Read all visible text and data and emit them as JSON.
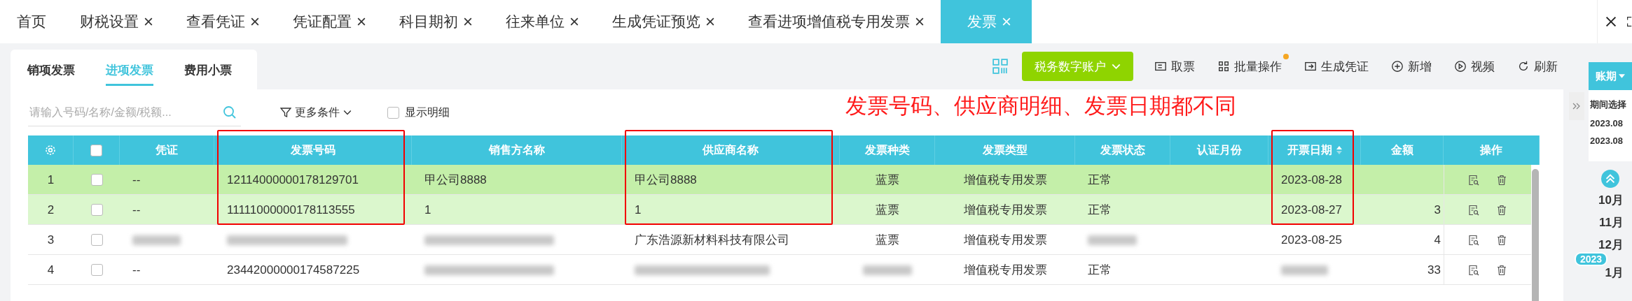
{
  "top_tabs": [
    {
      "label": "首页",
      "closable": false,
      "selected": false
    },
    {
      "label": "财税设置",
      "closable": true,
      "selected": false
    },
    {
      "label": "查看凭证",
      "closable": true,
      "selected": false
    },
    {
      "label": "凭证配置",
      "closable": true,
      "selected": false
    },
    {
      "label": "科目期初",
      "closable": true,
      "selected": false
    },
    {
      "label": "往来单位",
      "closable": true,
      "selected": false
    },
    {
      "label": "生成凭证预览",
      "closable": true,
      "selected": false
    },
    {
      "label": "查看进项增值税专用发票",
      "closable": true,
      "selected": false
    },
    {
      "label": "发票",
      "closable": true,
      "selected": true
    }
  ],
  "sub_tabs": [
    {
      "label": "销项发票",
      "selected": false
    },
    {
      "label": "进项发票",
      "selected": true
    },
    {
      "label": "费用小票",
      "selected": false
    }
  ],
  "toolbar": {
    "account_button": "税务数字账户",
    "actions": [
      {
        "kind": "ticket",
        "label": "取票",
        "badge": false
      },
      {
        "kind": "batch",
        "label": "批量操作",
        "badge": true
      },
      {
        "kind": "voucher",
        "label": "生成凭证",
        "badge": false
      },
      {
        "kind": "add",
        "label": "新增",
        "badge": false
      },
      {
        "kind": "video",
        "label": "视频",
        "badge": false
      },
      {
        "kind": "refresh",
        "label": "刷新",
        "badge": false
      }
    ]
  },
  "search": {
    "placeholder": "请输入号码/名称/金额/税额..."
  },
  "filter": {
    "more_label": "更多条件",
    "show_detail": {
      "label": "显示明细",
      "checked": false
    }
  },
  "annotation": "发票号码、供应商明细、发票日期都不同",
  "table": {
    "header_checked": false,
    "columns": [
      {
        "label": "凭证",
        "highlighted": false,
        "sortable": false
      },
      {
        "label": "发票号码",
        "highlighted": true,
        "sortable": false
      },
      {
        "label": "销售方名称",
        "highlighted": false,
        "sortable": false
      },
      {
        "label": "供应商名称",
        "highlighted": true,
        "sortable": false
      },
      {
        "label": "发票种类",
        "highlighted": false,
        "sortable": false
      },
      {
        "label": "发票类型",
        "highlighted": false,
        "sortable": false
      },
      {
        "label": "发票状态",
        "highlighted": false,
        "sortable": false
      },
      {
        "label": "认证月份",
        "highlighted": false,
        "sortable": false
      },
      {
        "label": "开票日期",
        "highlighted": true,
        "sortable": true
      },
      {
        "label": "金额",
        "highlighted": false,
        "sortable": false
      }
    ],
    "ops_label": "操作",
    "rows": [
      {
        "index": "1",
        "checked": false,
        "color": "#c4efa9",
        "cells": [
          {
            "text": "--"
          },
          {
            "text": "12114000000178129701"
          },
          {
            "text": "甲公司8888"
          },
          {
            "text": "甲公司8888"
          },
          {
            "text": "蓝票"
          },
          {
            "text": "增值税专用发票"
          },
          {
            "text": "正常"
          },
          null,
          {
            "text": "2023-08-28"
          },
          null
        ]
      },
      {
        "index": "2",
        "checked": false,
        "color": "#dbf7cd",
        "cells": [
          {
            "text": "--"
          },
          {
            "text": "11111000000178113555"
          },
          {
            "text": "1"
          },
          {
            "text": "1"
          },
          {
            "text": "蓝票"
          },
          {
            "text": "增值税专用发票"
          },
          {
            "text": "正常"
          },
          null,
          {
            "text": "2023-08-27"
          },
          {
            "text": "3"
          }
        ]
      },
      {
        "index": "3",
        "checked": false,
        "color": "#ffffff",
        "cells": [
          {
            "blurred": true
          },
          {
            "blurred": true
          },
          {
            "blurred": true
          },
          {
            "text": "广东浩源新材料科技有限公司"
          },
          {
            "text": "蓝票"
          },
          {
            "text": "增值税专用发票"
          },
          {
            "blurred": true
          },
          null,
          {
            "text": "2023-08-25"
          },
          {
            "text": "4"
          }
        ]
      },
      {
        "index": "4",
        "checked": false,
        "color": "#ffffff",
        "cells": [
          {
            "text": "--"
          },
          {
            "text": "23442000000174587225"
          },
          {
            "blurred": true
          },
          {
            "blurred": true
          },
          {
            "blurred": true
          },
          {
            "text": "增值税专用发票"
          },
          {
            "text": "正常"
          },
          null,
          {
            "blurred": true
          },
          {
            "text": "33"
          }
        ]
      }
    ]
  },
  "period_panel": {
    "button": "账期",
    "title": "期间选择",
    "dates": [
      "2023.08",
      "2023.08"
    ],
    "months": [
      "10月",
      "11月",
      "12月",
      "1月"
    ],
    "year_badge": "2023"
  }
}
